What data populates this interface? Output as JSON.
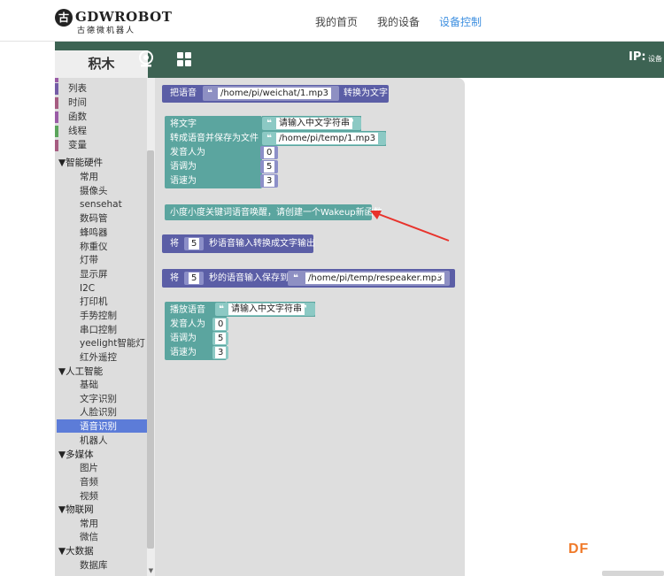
{
  "logo": {
    "mark": "古",
    "name": "GDWROBOT",
    "subtitle": "古德微机器人"
  },
  "nav": {
    "home": "我的首页",
    "devices": "我的设备",
    "control": "设备控制"
  },
  "header": {
    "tab": "积木",
    "ip_label": "IP:",
    "ip_value": "设备",
    "icons": [
      "webcam-icon",
      "grid-icon"
    ]
  },
  "toolbox": {
    "items": [
      {
        "label": "列表",
        "color": "#745ca6"
      },
      {
        "label": "时间",
        "color": "#a65c81"
      },
      {
        "label": "函数",
        "color": "#9a5ca6"
      },
      {
        "label": "线程",
        "color": "#5ba55b"
      },
      {
        "label": "变量",
        "color": "#a65c81"
      }
    ],
    "cat_hardware": "▼智能硬件",
    "hardware": [
      "常用",
      "摄像头",
      "sensehat",
      "数码管",
      "蜂鸣器",
      "称重仪",
      "灯带",
      "显示屏",
      "I2C",
      "打印机",
      "手势控制",
      "串口控制",
      "yeelight智能灯",
      "红外遥控"
    ],
    "cat_ai": "▼人工智能",
    "ai": [
      "基础",
      "文字识别",
      "人脸识别",
      "语音识别",
      "机器人"
    ],
    "selected": "语音识别",
    "cat_media": "▼多媒体",
    "media": [
      "图片",
      "音频",
      "视频"
    ],
    "cat_iot": "▼物联网",
    "iot": [
      "常用",
      "微信"
    ],
    "cat_data": "▼大数据",
    "data": [
      "数据库"
    ]
  },
  "blocks": {
    "b1": {
      "label": "把语音",
      "path": "/home/pi/weichat/1.mp3",
      "suffix": "转换为文字"
    },
    "b2": {
      "label1": "将文字",
      "text": "请输入中文字符串",
      "label2": "转成语音并保存为文件",
      "path": "/home/pi/temp/1.mp3",
      "label3": "发音人为",
      "v3": "0",
      "label4": "语调为",
      "v4": "5",
      "label5": "语速为",
      "v5": "3"
    },
    "b3": {
      "label": "小度小度关键词语音唤醒，请创建一个Wakeup新函数"
    },
    "b4": {
      "label1": "将",
      "num": "5",
      "label2": "秒语音输入转换成文字输出"
    },
    "b5": {
      "label1": "将",
      "num": "5",
      "label2": "秒的语音输入保存到",
      "path": "/home/pi/temp/respeaker.mp3"
    },
    "b6": {
      "label1": "播放语音",
      "text": "请输入中文字符串",
      "label2": "发音人为",
      "v2": "0",
      "label3": "语调为",
      "v3": "5",
      "label4": "语速为",
      "v4": "3"
    },
    "quote_open": "❝",
    "quote_close": "❞"
  },
  "watermark": "DF",
  "colors": {
    "green_bar": "#3d6353",
    "purple_block": "#5b5ea6",
    "teal_block": "#5ba59f",
    "selected": "#5c7cd8",
    "nav_active": "#3d8fe0",
    "arrow": "#e8332c"
  }
}
